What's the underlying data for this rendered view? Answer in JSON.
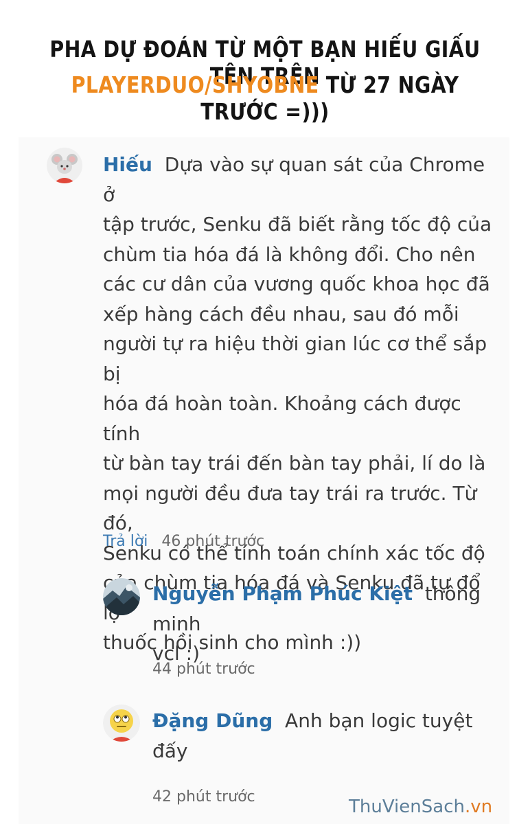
{
  "banner": {
    "line1": "PHA DỰ ĐOÁN TỪ MỘT BẠN HIẾU GIẤU TÊN TRÊN",
    "line2_accent": "PLAYERDUO/SHYOBNE",
    "line2_rest": " TỪ 27 NGÀY TRƯỚC =)))"
  },
  "comments": [
    {
      "author": "Hiếu",
      "avatar_icon": "mouse-emoji-icon",
      "lines": [
        "Dựa vào sự quan sát của Chrome ở",
        "tập trước, Senku đã biết rằng tốc độ của",
        "chùm tia hóa đá là không đổi. Cho nên",
        "các cư dân của vương quốc khoa học đã",
        "xếp hàng cách đều nhau, sau đó mỗi",
        "người tự ra hiệu thời gian lúc cơ thể sắp bị",
        "hóa đá hoàn toàn. Khoảng cách được tính",
        "từ bàn tay trái đến bàn tay phải, lí do là",
        "mọi người đều đưa tay trái ra trước. Từ đó,",
        "Senku có thể tính toán chính xác tốc độ",
        "của chùm tia hóa đá và Senku đã tự đổ lọ",
        "thuốc hồi sinh cho mình :))"
      ],
      "reply_label": "Trả lời",
      "time": "46 phút trước"
    },
    {
      "author": "Nguyễn Phạm Phúc Kiệt",
      "avatar_icon": "photo-avatar-icon",
      "lines": [
        "thông minh",
        "vcl :)"
      ],
      "time": "44 phút trước"
    },
    {
      "author": "Đặng Dũng",
      "avatar_icon": "rolling-eyes-emoji-icon",
      "lines": [
        "Anh bạn logic tuyệt",
        "đấy"
      ],
      "time": "42 phút trước"
    }
  ],
  "watermark": {
    "part1": "ThuVienSach",
    "part2": ".vn"
  },
  "colors": {
    "accent": "#ee8a1f",
    "author": "#2b6ea8",
    "reply": "#3c7ab3"
  }
}
